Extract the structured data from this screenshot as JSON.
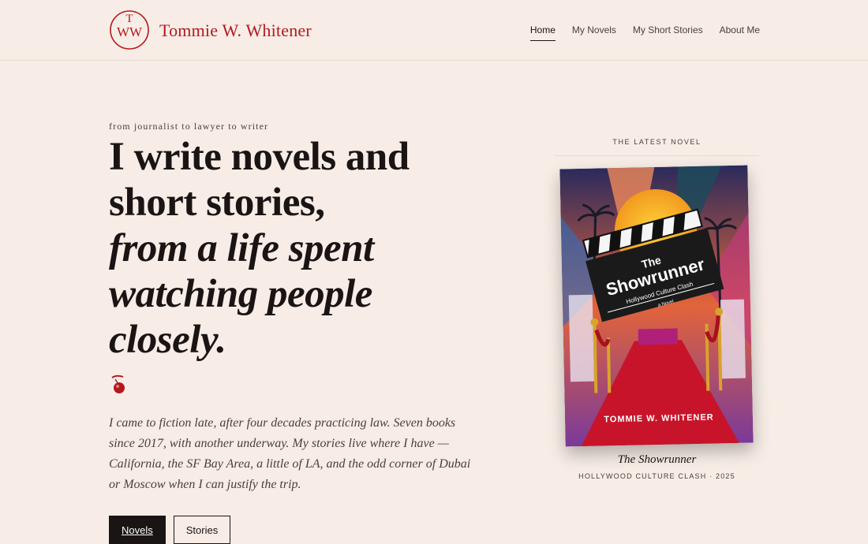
{
  "brand": {
    "monogram": "TWW",
    "name": "Tommie W. Whitener",
    "accent_color": "#b3181f"
  },
  "nav": {
    "items": [
      {
        "label": "Home",
        "active": true
      },
      {
        "label": "My Novels",
        "active": false
      },
      {
        "label": "My Short Stories",
        "active": false
      },
      {
        "label": "About Me",
        "active": false
      }
    ]
  },
  "hero": {
    "eyebrow": "from journalist to lawyer to writer",
    "headline_lines": [
      "I write novels and",
      "short stories,",
      "from a life spent",
      "watching people",
      "closely."
    ],
    "ornament_icon": "cherry-ornament-icon",
    "intro": "I came to fiction late, after four decades practicing law. Seven books since 2017, with another underway. My stories live where I have — California, the SF Bay Area, a little of LA, and the odd corner of Dubai or Moscow when I can justify the trip.",
    "buttons": {
      "primary": "Novels",
      "secondary": "Stories"
    }
  },
  "feature": {
    "label": "THE LATEST NOVEL",
    "cover": {
      "title_line1": "The",
      "title_line2": "Showrunner",
      "subtitle": "Hollywood Culture Clash",
      "tag": "a Novel",
      "author": "TOMMIE W. WHITENER"
    },
    "book_title": "The Showrunner",
    "book_meta": "HOLLYWOOD CULTURE CLASH · 2025"
  }
}
